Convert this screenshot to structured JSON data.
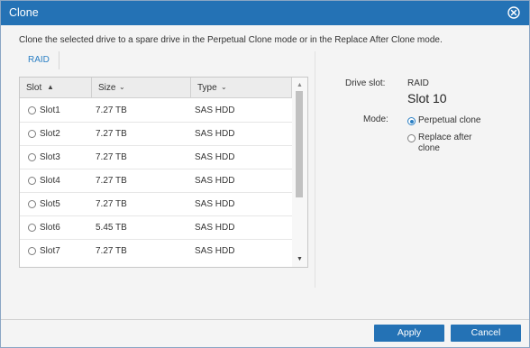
{
  "dialog": {
    "title": "Clone",
    "close_icon": "close-circle-icon",
    "description": "Clone the selected drive to a spare drive in the Perpetual Clone mode or in the Replace After Clone mode."
  },
  "tab": {
    "label": "RAID"
  },
  "grid": {
    "columns": [
      {
        "label": "Slot",
        "sort": "asc",
        "icon": "sort-up-icon"
      },
      {
        "label": "Size",
        "sort": "none",
        "icon": "chevron-down-icon"
      },
      {
        "label": "Type",
        "sort": "none",
        "icon": "chevron-down-icon"
      }
    ],
    "rows": [
      {
        "slot": "Slot1",
        "size": "7.27 TB",
        "type": "SAS HDD"
      },
      {
        "slot": "Slot2",
        "size": "7.27 TB",
        "type": "SAS HDD"
      },
      {
        "slot": "Slot3",
        "size": "7.27 TB",
        "type": "SAS HDD"
      },
      {
        "slot": "Slot4",
        "size": "7.27 TB",
        "type": "SAS HDD"
      },
      {
        "slot": "Slot5",
        "size": "7.27 TB",
        "type": "SAS HDD"
      },
      {
        "slot": "Slot6",
        "size": "5.45 TB",
        "type": "SAS HDD"
      },
      {
        "slot": "Slot7",
        "size": "7.27 TB",
        "type": "SAS HDD"
      }
    ]
  },
  "details": {
    "drive_slot_label": "Drive slot:",
    "drive_slot_group": "RAID",
    "drive_slot_value": "Slot 10",
    "mode_label": "Mode:",
    "mode_options": [
      {
        "label": "Perpetual clone",
        "selected": true
      },
      {
        "label_line1": "Replace after",
        "label_line2": "clone",
        "selected": false
      }
    ]
  },
  "buttons": {
    "apply": "Apply",
    "cancel": "Cancel"
  },
  "colors": {
    "accent": "#2472b5",
    "link": "#2a7fc4"
  }
}
